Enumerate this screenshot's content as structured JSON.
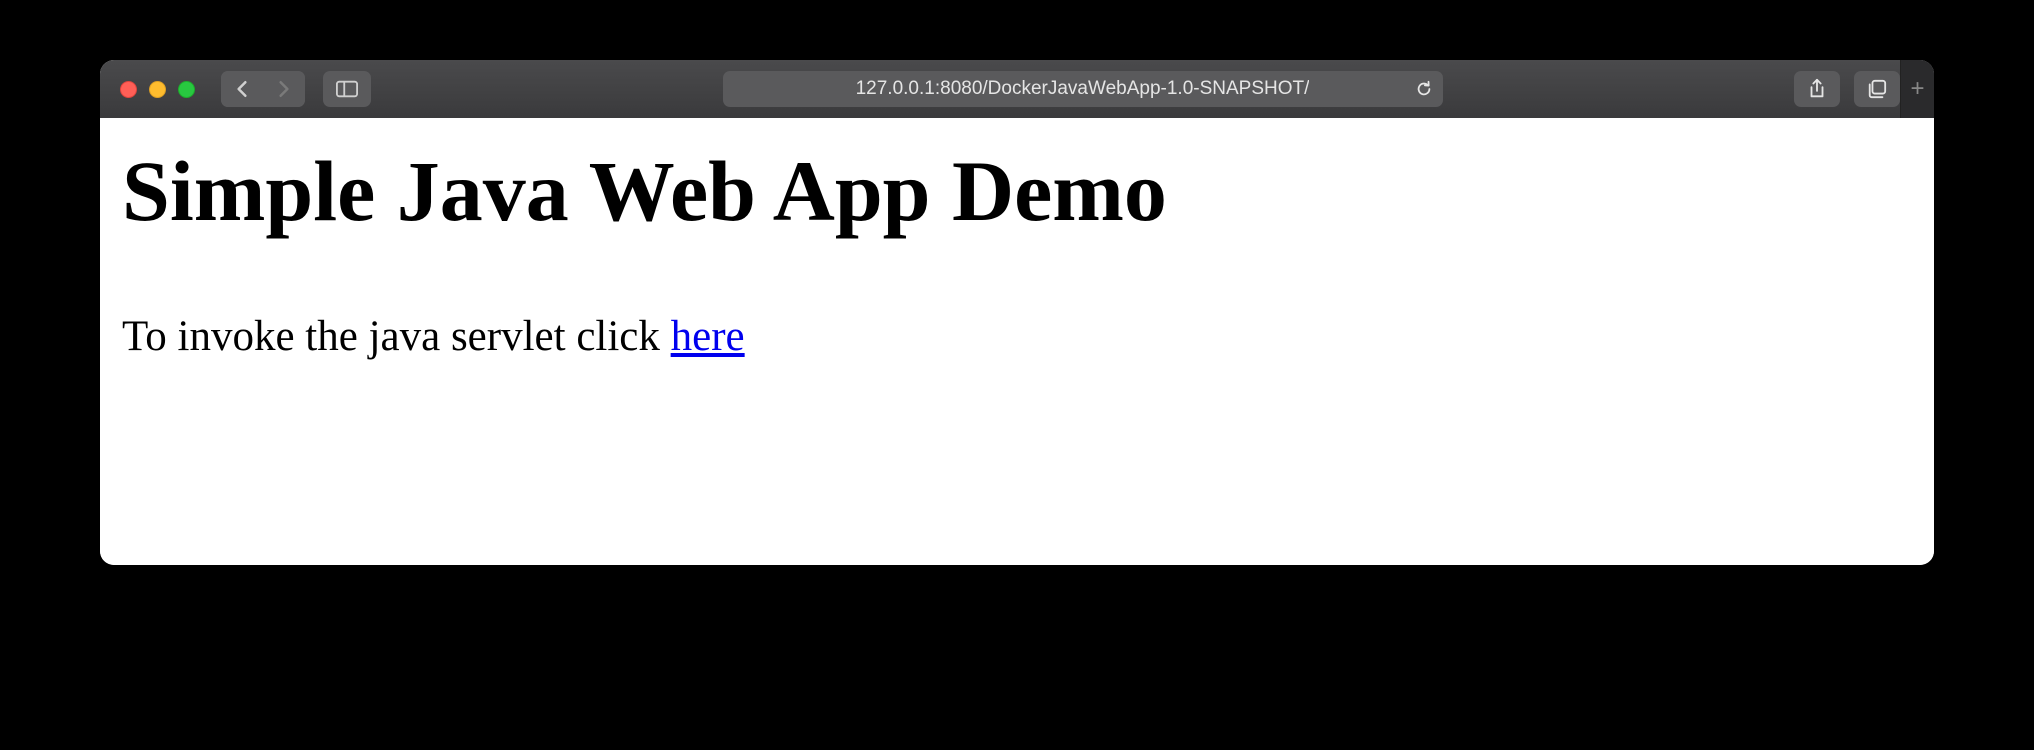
{
  "toolbar": {
    "address": "127.0.0.1:8080/DockerJavaWebApp-1.0-SNAPSHOT/",
    "new_tab_label": "+"
  },
  "page": {
    "heading": "Simple Java Web App Demo",
    "paragraph_prefix": "To invoke the java servlet click ",
    "link_text": "here"
  }
}
